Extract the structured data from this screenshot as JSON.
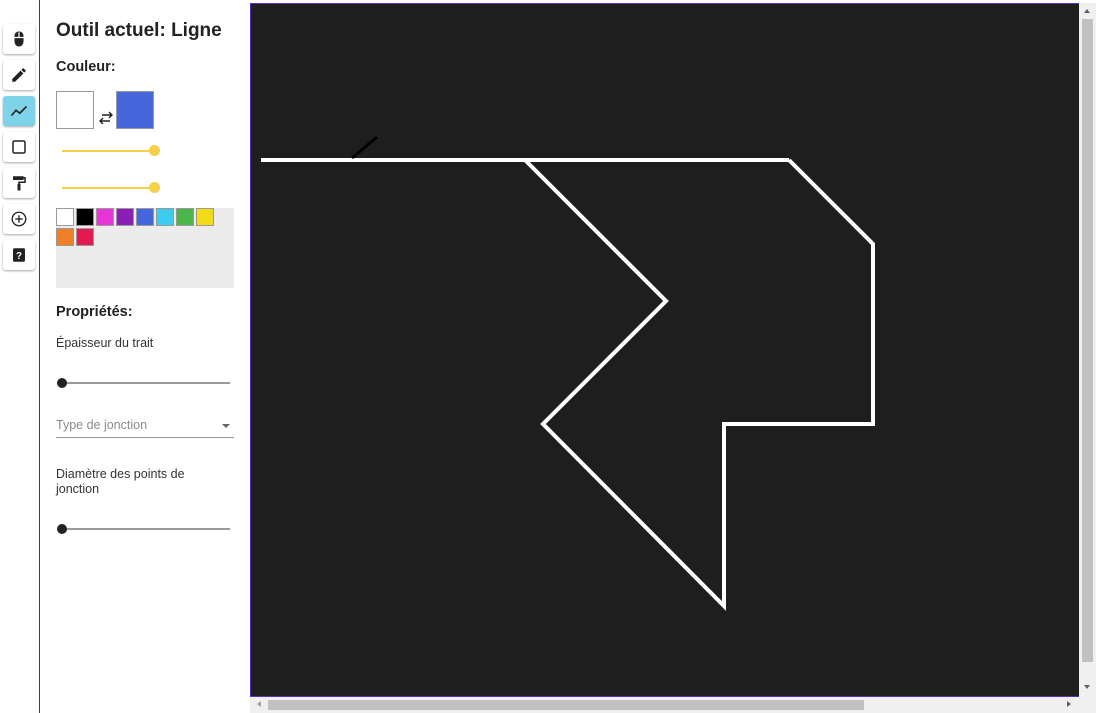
{
  "toolbar": {
    "tools": [
      {
        "name": "select",
        "icon": "mouse-icon",
        "active": false
      },
      {
        "name": "pencil",
        "icon": "pencil-icon",
        "active": false
      },
      {
        "name": "line",
        "icon": "line-chart-icon",
        "active": true
      },
      {
        "name": "rectangle",
        "icon": "square-icon",
        "active": false
      },
      {
        "name": "paint-roller",
        "icon": "paint-roller-icon",
        "active": false
      },
      {
        "name": "add",
        "icon": "circle-plus-icon",
        "active": false
      },
      {
        "name": "help",
        "icon": "help-icon",
        "active": false
      }
    ]
  },
  "panel": {
    "title": "Outil actuel: Ligne",
    "color_label": "Couleur:",
    "primary_color": "#ffffff",
    "secondary_color": "#4666dc",
    "primary_opacity": 1.0,
    "secondary_opacity": 1.0,
    "palette": [
      "#ffffff",
      "#000000",
      "#e836d6",
      "#8a1fb5",
      "#4666dc",
      "#3ecbef",
      "#4cb64c",
      "#f2dc1a",
      "#f07f2a",
      "#e4194f"
    ],
    "properties_label": "Propriétés:",
    "stroke_width_label": "Épaisseur du trait",
    "stroke_width_value": 0,
    "join_type_placeholder": "Type de jonction",
    "join_diameter_label": "Diamètre des points de jonction",
    "join_diameter_value": 0
  },
  "canvas": {
    "background": "#1e1e1e",
    "stroke_color": "#ffffff"
  },
  "scrollbars": {
    "vertical_position": 0.0,
    "horizontal_position": 0.0
  }
}
